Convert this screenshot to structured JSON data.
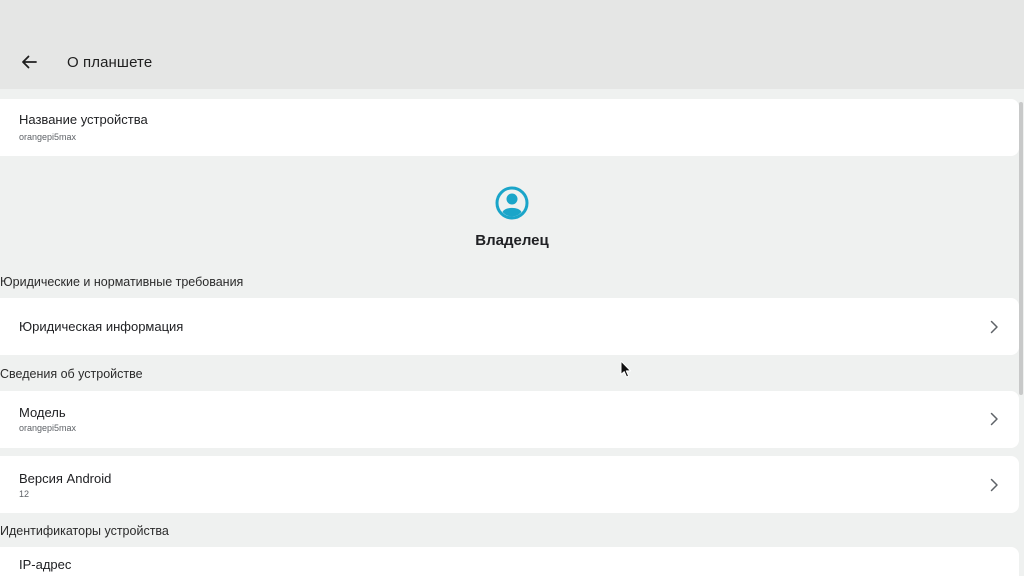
{
  "app_bar": {
    "title": "О планшете",
    "back_icon": "arrow-left-icon"
  },
  "peek_text": "-",
  "device_name": {
    "title": "Название устройства",
    "value": "orangepi5max"
  },
  "owner": {
    "icon": "account-circle-icon",
    "name": "Владелец",
    "icon_color": "#1aa5c9"
  },
  "sections": {
    "legal": {
      "header": "Юридические и нормативные требования",
      "legal_info": "Юридическая информация"
    },
    "device_info": {
      "header": "Сведения об устройстве",
      "model": {
        "title": "Модель",
        "value": "orangepi5max"
      },
      "android_version": {
        "title": "Версия Android",
        "value": "12"
      }
    },
    "identifiers": {
      "header": "Идентификаторы устройства",
      "ip_address": {
        "title": "IP-адрес"
      }
    }
  },
  "colors": {
    "background": "#eff1f0",
    "app_bar": "#e5e6e5",
    "card": "#ffffff",
    "accent": "#1aa5c9"
  }
}
